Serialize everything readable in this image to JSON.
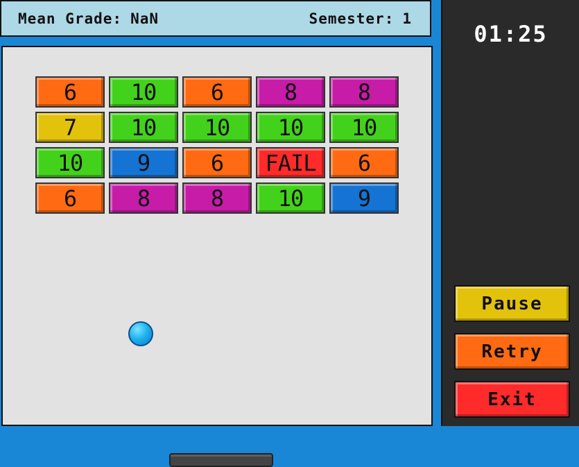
{
  "header": {
    "mean_label": "Mean Grade:",
    "mean_value": "NaN",
    "semester_label": "Semester:",
    "semester_value": "1"
  },
  "timer": "01:25",
  "buttons": {
    "pause": "Pause",
    "retry": "Retry",
    "exit": "Exit"
  },
  "colors": {
    "orange": "#ff6a12",
    "green": "#43d21b",
    "magenta": "#c61ca8",
    "yellow": "#e3c20c",
    "blue": "#1573d4",
    "red": "#ff2a2a"
  },
  "bricks": [
    [
      {
        "label": "6",
        "color": "orange"
      },
      {
        "label": "10",
        "color": "green"
      },
      {
        "label": "6",
        "color": "orange"
      },
      {
        "label": "8",
        "color": "magenta"
      },
      {
        "label": "8",
        "color": "magenta"
      }
    ],
    [
      {
        "label": "7",
        "color": "yellow"
      },
      {
        "label": "10",
        "color": "green"
      },
      {
        "label": "10",
        "color": "green"
      },
      {
        "label": "10",
        "color": "green"
      },
      {
        "label": "10",
        "color": "green"
      }
    ],
    [
      {
        "label": "10",
        "color": "green"
      },
      {
        "label": "9",
        "color": "blue"
      },
      {
        "label": "6",
        "color": "orange"
      },
      {
        "label": "FAIL",
        "color": "red"
      },
      {
        "label": "6",
        "color": "orange"
      }
    ],
    [
      {
        "label": "6",
        "color": "orange"
      },
      {
        "label": "8",
        "color": "magenta"
      },
      {
        "label": "8",
        "color": "magenta"
      },
      {
        "label": "10",
        "color": "green"
      },
      {
        "label": "9",
        "color": "blue"
      }
    ]
  ]
}
